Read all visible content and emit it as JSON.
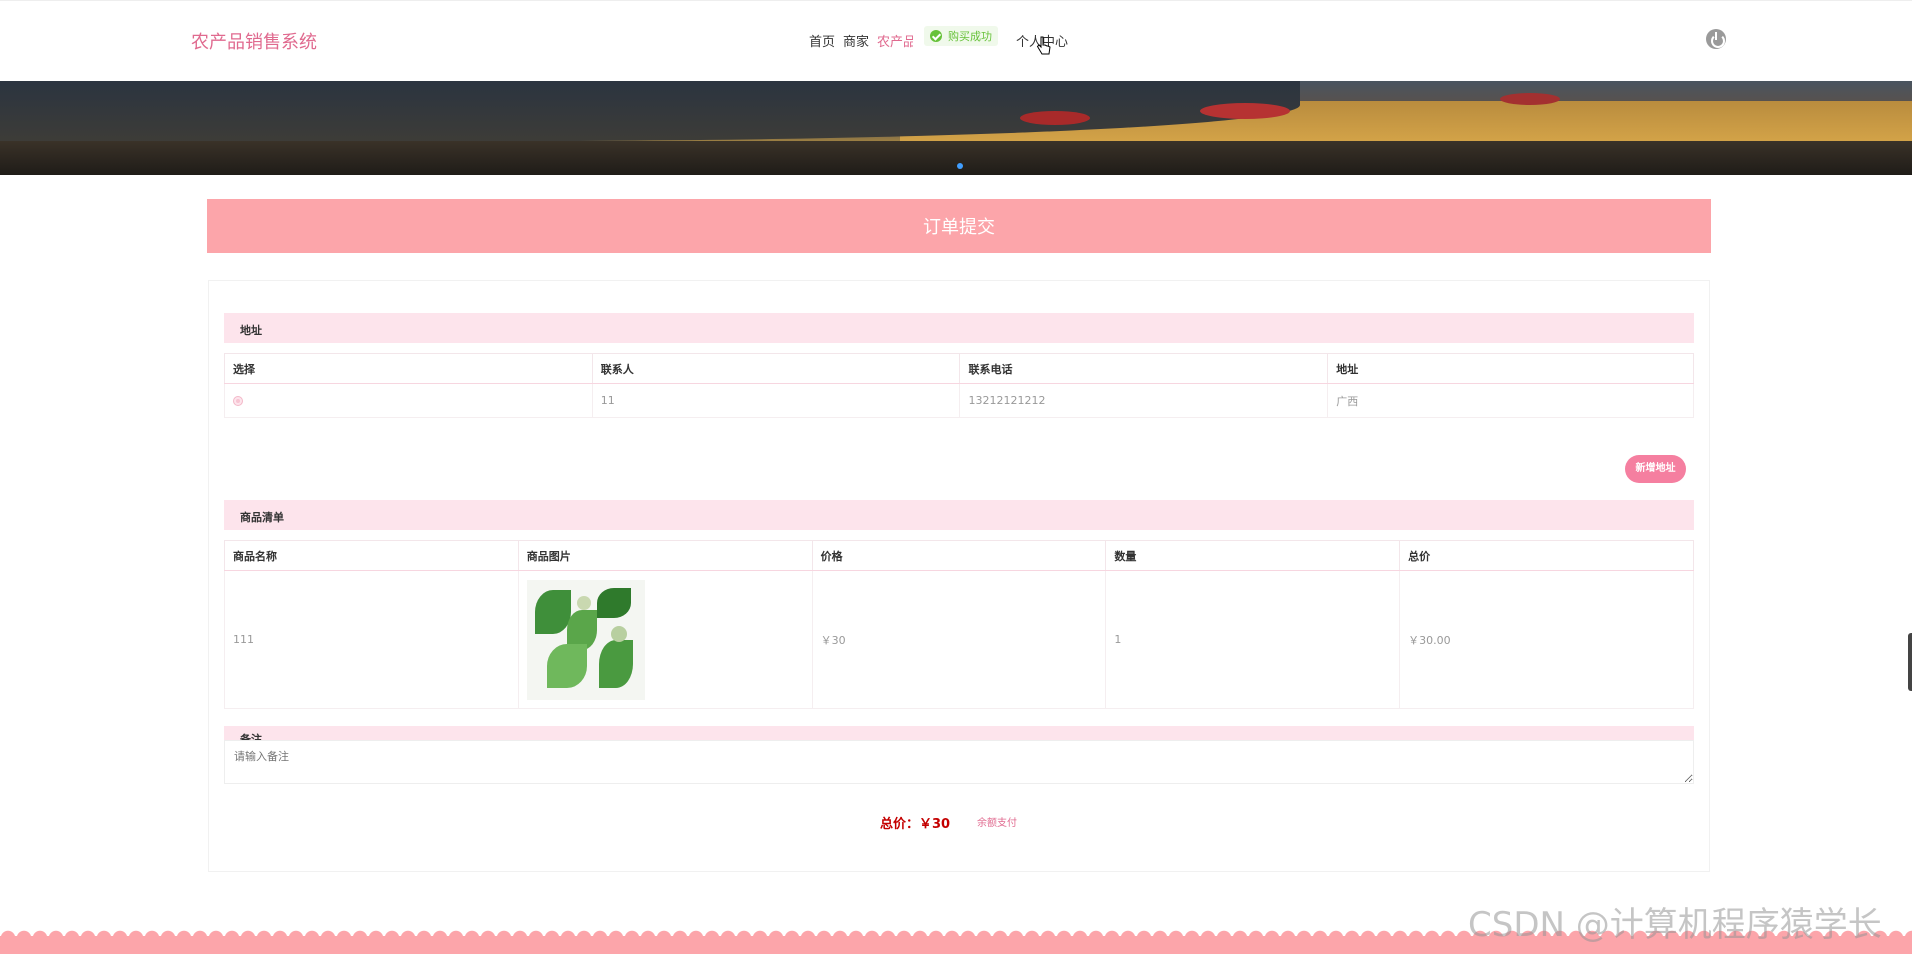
{
  "header": {
    "logo": "农产品销售系统",
    "nav": [
      "首页",
      "商家",
      "农产品"
    ],
    "nav_user": "个人中心",
    "toast": "购买成功"
  },
  "page_title": "订单提交",
  "address": {
    "section_title": "地址",
    "columns": [
      "选择",
      "联系人",
      "联系电话",
      "地址"
    ],
    "rows": [
      {
        "contact": "11",
        "phone": "13212121212",
        "address": "广西"
      }
    ],
    "add_button": "新增地址"
  },
  "goods": {
    "section_title": "商品清单",
    "columns": [
      "商品名称",
      "商品图片",
      "价格",
      "数量",
      "总价"
    ],
    "rows": [
      {
        "name": "111",
        "price": "￥30",
        "quantity": "1",
        "total": "￥30.00"
      }
    ]
  },
  "remark": {
    "section_title": "备注",
    "placeholder": "请输入备注"
  },
  "summary": {
    "total_label": "总价：",
    "total_value": "￥30",
    "pay_button": "余额支付"
  },
  "watermark": "CSDN @计算机程序猿学长",
  "colors": {
    "brand_pink": "#e06a8f",
    "band_pink": "#fca5aa",
    "section_pink": "#fde4ec",
    "button_pink": "#f57fa0",
    "success_green": "#67c23a",
    "price_red": "#c40000"
  }
}
